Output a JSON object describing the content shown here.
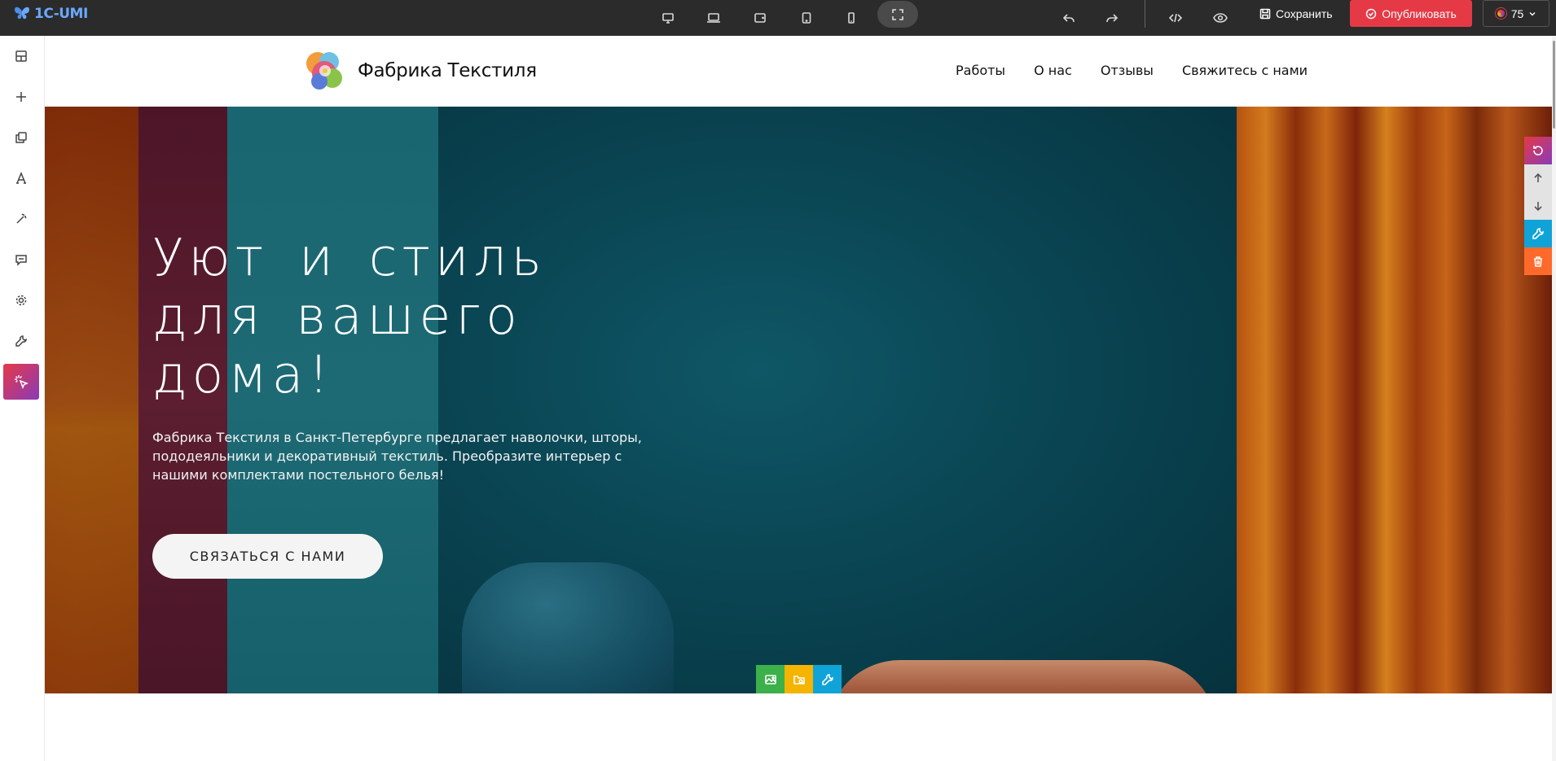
{
  "app": {
    "logo_text": "1C-UMI",
    "save_label": "Сохранить",
    "publish_label": "Опубликовать",
    "user_score": "75"
  },
  "toolbar": {
    "devices": [
      "desktop-icon",
      "laptop-icon",
      "tablet-landscape-icon",
      "tablet-portrait-icon",
      "mobile-icon",
      "fullscreen-icon"
    ],
    "actions": [
      "undo-icon",
      "redo-icon",
      "code-icon",
      "preview-eye-icon"
    ]
  },
  "sidebar": {
    "items": [
      "blocks-icon",
      "add-icon",
      "pages-icon",
      "typography-icon",
      "magic-icon",
      "comments-icon",
      "settings-icon",
      "tools-icon",
      "interactive-icon"
    ]
  },
  "site": {
    "name": "Фабрика Текстиля",
    "nav": [
      "Работы",
      "О нас",
      "Отзывы",
      "Свяжитесь с нами"
    ]
  },
  "hero": {
    "title": "Уют и стиль для вашего дома!",
    "text": "Фабрика Текстиля в Санкт-Петербурге предлагает наволочки, шторы, пододеяльники и декоративный текстиль. Преобразите интерьер с нашими комплектами постельного белья!",
    "cta_label": "СВЯЗАТЬСЯ С НАМИ"
  },
  "colors": {
    "topbar": "#2b2b2b",
    "publish": "#e63946",
    "accent_gradient_start": "#e63946",
    "accent_gradient_end": "#8a3ab9",
    "settings_blue": "#10a3d8",
    "delete_orange": "#ff6a2b",
    "image_green": "#3cb04a",
    "folder_yellow": "#f4b400"
  }
}
